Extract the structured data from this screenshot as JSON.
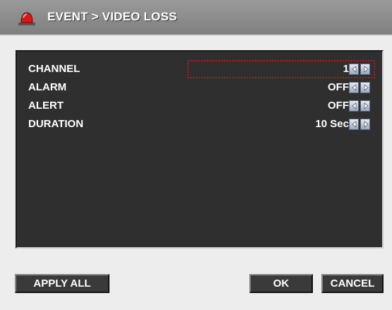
{
  "window": {
    "title": "EVENT > VIDEO LOSS",
    "icon": "alarm-siren-icon"
  },
  "settings": [
    {
      "label": "CHANNEL",
      "value": "1"
    },
    {
      "label": "ALARM",
      "value": "OFF"
    },
    {
      "label": "ALERT",
      "value": "OFF"
    },
    {
      "label": "DURATION",
      "value": "10 Sec"
    }
  ],
  "buttons": {
    "apply_all": "APPLY ALL",
    "ok": "OK",
    "cancel": "CANCEL"
  },
  "colors": {
    "panel": "#2f2f2f",
    "titlebar": "#8c8c8c",
    "focus": "#c01818"
  }
}
